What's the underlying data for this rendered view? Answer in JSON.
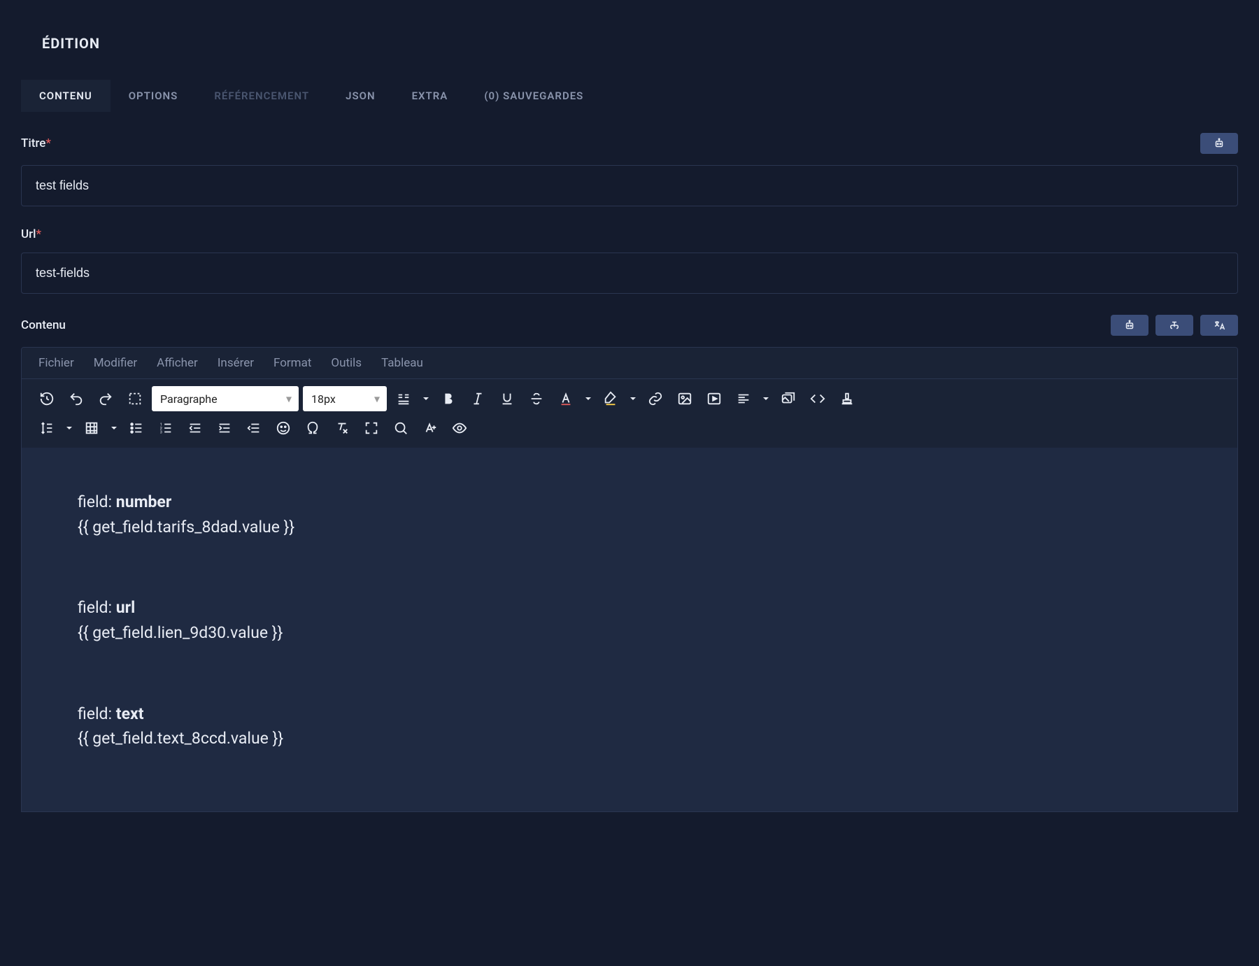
{
  "header": {
    "title": "ÉDITION"
  },
  "tabs": [
    {
      "label": "CONTENU",
      "state": "active"
    },
    {
      "label": "OPTIONS",
      "state": "normal"
    },
    {
      "label": "RÉFÉRENCEMENT",
      "state": "disabled"
    },
    {
      "label": "JSON",
      "state": "normal"
    },
    {
      "label": "EXTRA",
      "state": "normal"
    },
    {
      "label": "(0) SAUVEGARDES",
      "state": "normal"
    }
  ],
  "fields": {
    "title": {
      "label": "Titre",
      "required": true,
      "value": "test fields"
    },
    "url": {
      "label": "Url",
      "required": true,
      "value": "test-fields"
    },
    "content": {
      "label": "Contenu"
    }
  },
  "editor": {
    "menubar": [
      "Fichier",
      "Modifier",
      "Afficher",
      "Insérer",
      "Format",
      "Outils",
      "Tableau"
    ],
    "block_format": "Paragraphe",
    "font_size": "18px",
    "content_lines": [
      {
        "prefix": "field: ",
        "bold": "number",
        "code": "{{ get_field.tarifs_8dad.value }}"
      },
      {
        "prefix": "field: ",
        "bold": "url",
        "code": "{{ get_field.lien_9d30.value }}"
      },
      {
        "prefix": "field: ",
        "bold": "text",
        "code": "{{ get_field.text_8ccd.value }}"
      }
    ]
  }
}
